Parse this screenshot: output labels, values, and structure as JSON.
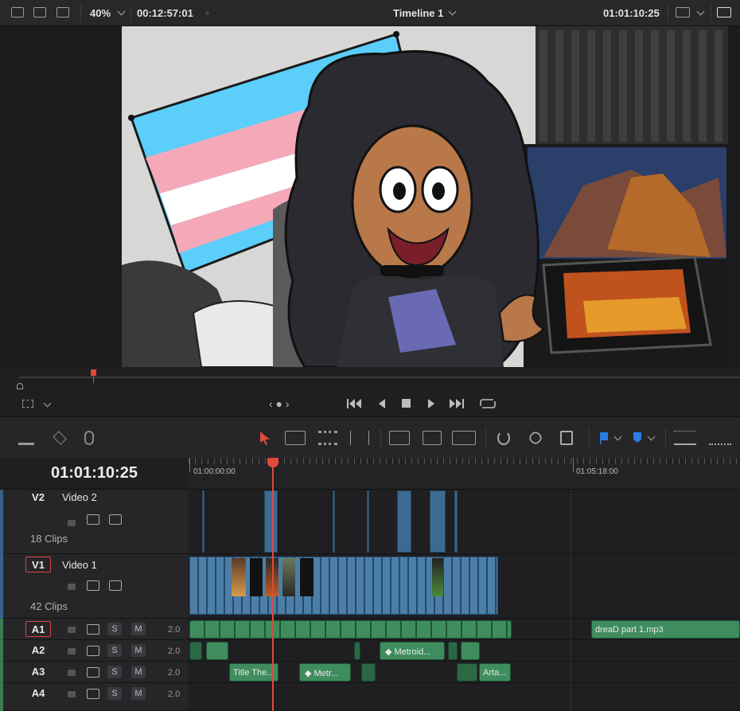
{
  "topbar": {
    "zoom": "40%",
    "duration": "00:12:57:01",
    "timeline_name": "Timeline 1",
    "timecode": "01:01:10:25"
  },
  "transport": {
    "jog": "‹ ● ›"
  },
  "timeline": {
    "current_timecode": "01:01:10:25",
    "ruler_labels": [
      "01:00:00:00",
      "01:05:18:00"
    ],
    "tracks": {
      "v2": {
        "id": "V2",
        "name": "Video 2",
        "clips": "18 Clips"
      },
      "v1": {
        "id": "V1",
        "name": "Video 1",
        "clips": "42 Clips"
      },
      "a1": {
        "id": "A1",
        "s": "S",
        "m": "M",
        "vol": "2.0"
      },
      "a2": {
        "id": "A2",
        "s": "S",
        "m": "M",
        "vol": "2.0"
      },
      "a3": {
        "id": "A3",
        "s": "S",
        "m": "M",
        "vol": "2.0"
      },
      "a4": {
        "id": "A4",
        "s": "S",
        "m": "M",
        "vol": "2.0"
      }
    },
    "clip_labels": {
      "a1_music": "dreaD part 1.mp3",
      "a2_metroid": "Metroid...",
      "a3_title": "Title The...",
      "a3_metr": "Metr...",
      "a3_arta": "Arta..."
    }
  },
  "colors": {
    "playhead": "#e04a3a",
    "video_clip": "#4c7fa8",
    "audio_clip": "#3f8d5e",
    "flag_blue": "#2a7de1"
  }
}
